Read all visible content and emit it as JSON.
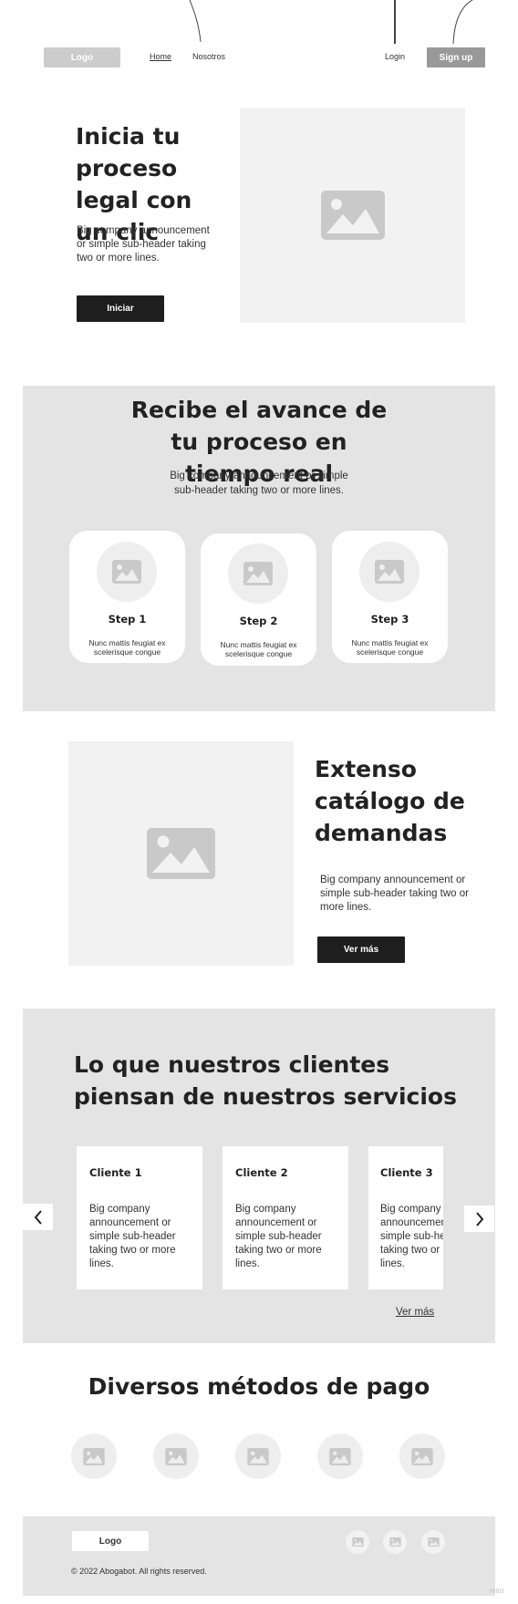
{
  "header": {
    "logo": "Logo",
    "nav": [
      {
        "label": "Home"
      },
      {
        "label": "Nosotros"
      }
    ],
    "login": "Login",
    "signup": "Sign up"
  },
  "hero": {
    "title": "Inicia tu proceso legal con un clic",
    "subtitle": "Big company announcement or simple sub-header taking two or more lines.",
    "button": "Iniciar"
  },
  "progress": {
    "title": "Recibe el avance de tu proceso en tiempo real",
    "subtitle": "Big company announcement or simple sub-header taking two or more lines.",
    "steps": [
      {
        "title": "Step 1",
        "text": "Nunc mattis feugiat ex scelerisque congue"
      },
      {
        "title": "Step 2",
        "text": "Nunc mattis feugiat ex scelerisque congue"
      },
      {
        "title": "Step 3",
        "text": "Nunc mattis feugiat ex scelerisque congue"
      }
    ]
  },
  "catalog": {
    "title": "Extenso catálogo de demandas",
    "subtitle": "Big company announcement or simple sub-header taking two or more lines.",
    "button": "Ver más"
  },
  "testimonials": {
    "title": "Lo que nuestros clientes piensan de nuestros servicios",
    "cards": [
      {
        "name": "Cliente 1",
        "text": "Big company announcement or simple sub-header taking two or more lines."
      },
      {
        "name": "Cliente 2",
        "text": "Big company announcement or simple sub-header taking two or more lines."
      },
      {
        "name": "Cliente 3",
        "text": "Big company announcement or simple sub-header taking two or more lines."
      }
    ],
    "more_link": "Ver más",
    "prev_icon": "chevron-left-icon",
    "next_icon": "chevron-right-icon"
  },
  "payments": {
    "title": "Diversos métodos de pago",
    "methods": [
      "image-icon",
      "image-icon",
      "image-icon",
      "image-icon",
      "image-icon"
    ]
  },
  "footer": {
    "logo": "Logo",
    "copyright": "© 2022 Abogabot. All rights reserved.",
    "social": [
      "image-icon",
      "image-icon",
      "image-icon"
    ]
  },
  "watermark": "miro",
  "colors": {
    "section_bg": "#e4e4e4",
    "placeholder_bg": "#f2f2f2",
    "icon_gray": "#c9c9c9",
    "button_dark": "#1e1e1e",
    "logo_bg": "#cccccc",
    "signup_bg": "#999999"
  }
}
